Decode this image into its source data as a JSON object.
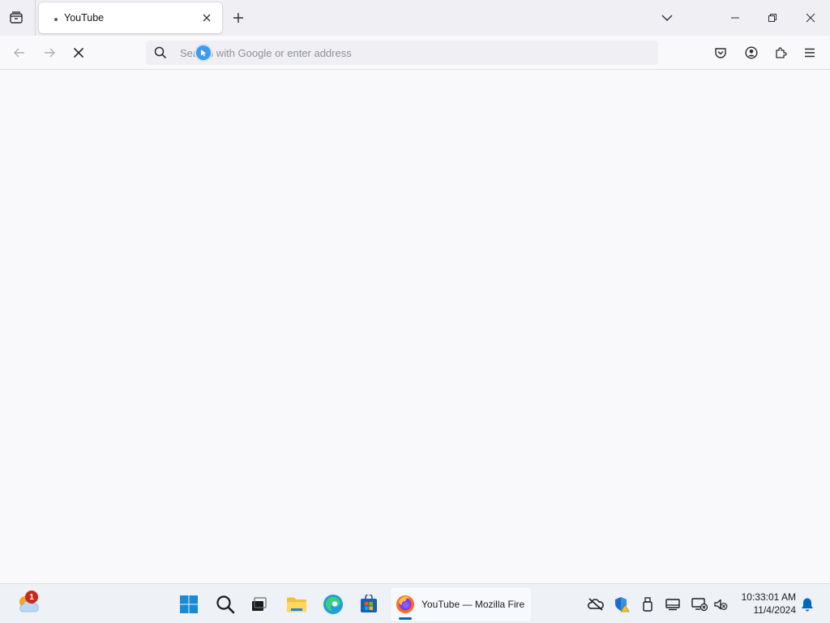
{
  "browser": {
    "tab": {
      "title": "YouTube",
      "state": "loading"
    },
    "urlbar": {
      "placeholder": "Search with Google or enter address",
      "value": ""
    }
  },
  "icons": {
    "tab_list": "tab-list-icon",
    "close_tab": "close-icon",
    "new_tab": "plus-icon",
    "all_tabs": "chevron-down-icon",
    "back": "back-arrow-icon",
    "forward": "forward-arrow-icon",
    "stop": "stop-icon",
    "search": "search-icon",
    "pocket": "pocket-icon",
    "account": "account-icon",
    "extensions": "puzzle-icon",
    "menu": "hamburger-menu-icon"
  },
  "taskbar": {
    "weather": {
      "badge": "1"
    },
    "active_app": {
      "label": "YouTube — Mozilla Fire"
    },
    "clock": {
      "time": "10:33:01 AM",
      "date": "11/4/2024"
    }
  },
  "colors": {
    "accent": "#0067c0",
    "page_bg": "#f9f9fb",
    "tabstrip_bg": "#f0f0f4",
    "notification_badge": "#c42b1c"
  }
}
